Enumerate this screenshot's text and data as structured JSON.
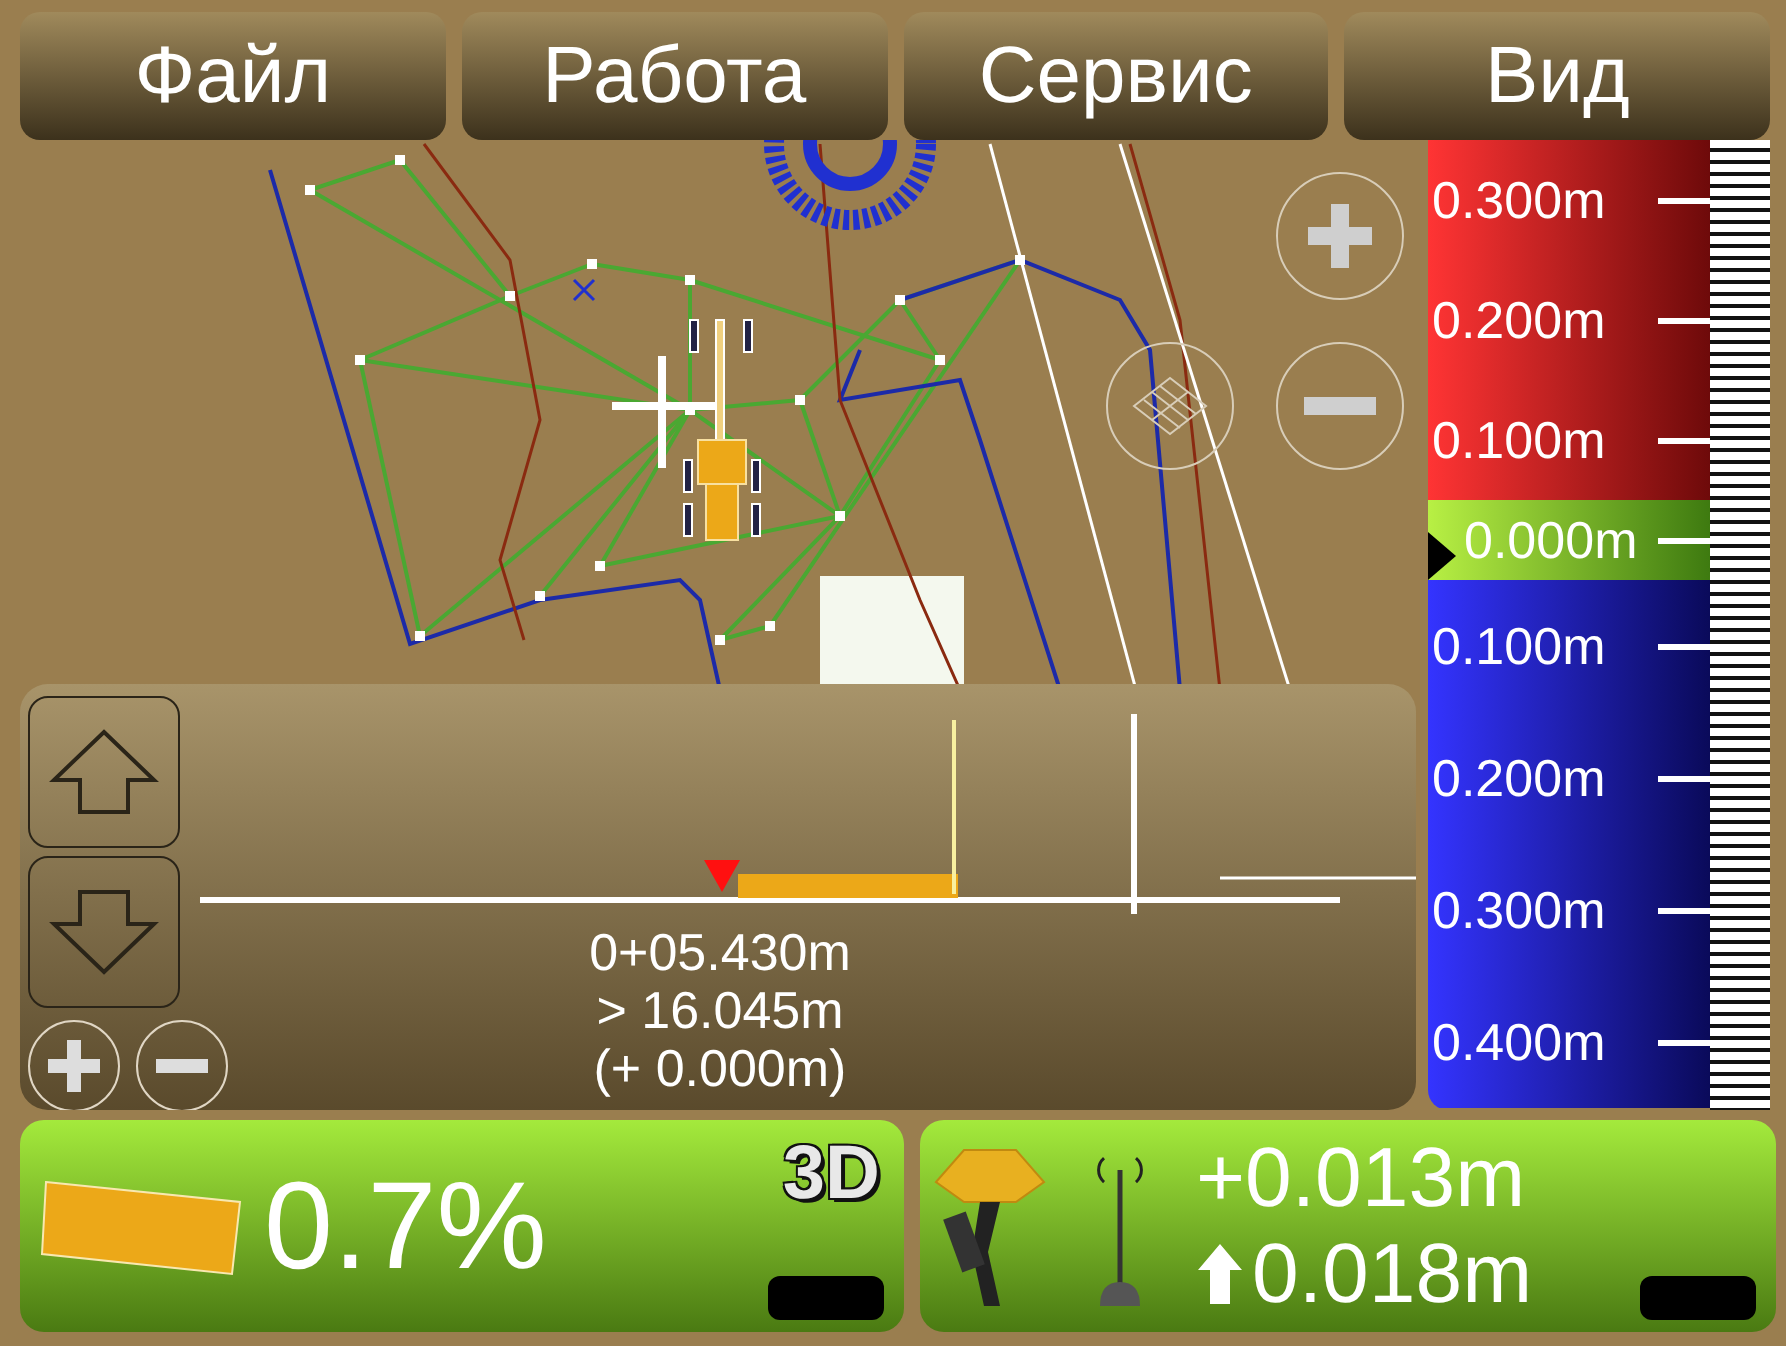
{
  "menu": [
    {
      "label": "Файл"
    },
    {
      "label": "Работа"
    },
    {
      "label": "Сервис"
    },
    {
      "label": "Вид"
    }
  ],
  "scale": {
    "ticks": [
      {
        "label": "0.300m",
        "kind": "cut"
      },
      {
        "label": "0.200m",
        "kind": "cut"
      },
      {
        "label": "0.100m",
        "kind": "cut"
      },
      {
        "label": "0.000m",
        "kind": "on"
      },
      {
        "label": "0.100m",
        "kind": "fill"
      },
      {
        "label": "0.200m",
        "kind": "fill"
      },
      {
        "label": "0.300m",
        "kind": "fill"
      },
      {
        "label": "0.400m",
        "kind": "fill"
      }
    ]
  },
  "profile": {
    "station": "0+05.430m",
    "distance": "> 16.045m",
    "offset": "(+ 0.000m)"
  },
  "grade": {
    "value": "0.7%",
    "mode": "3D"
  },
  "elevation": {
    "offset": "+0.013m",
    "height": "0.018m"
  }
}
